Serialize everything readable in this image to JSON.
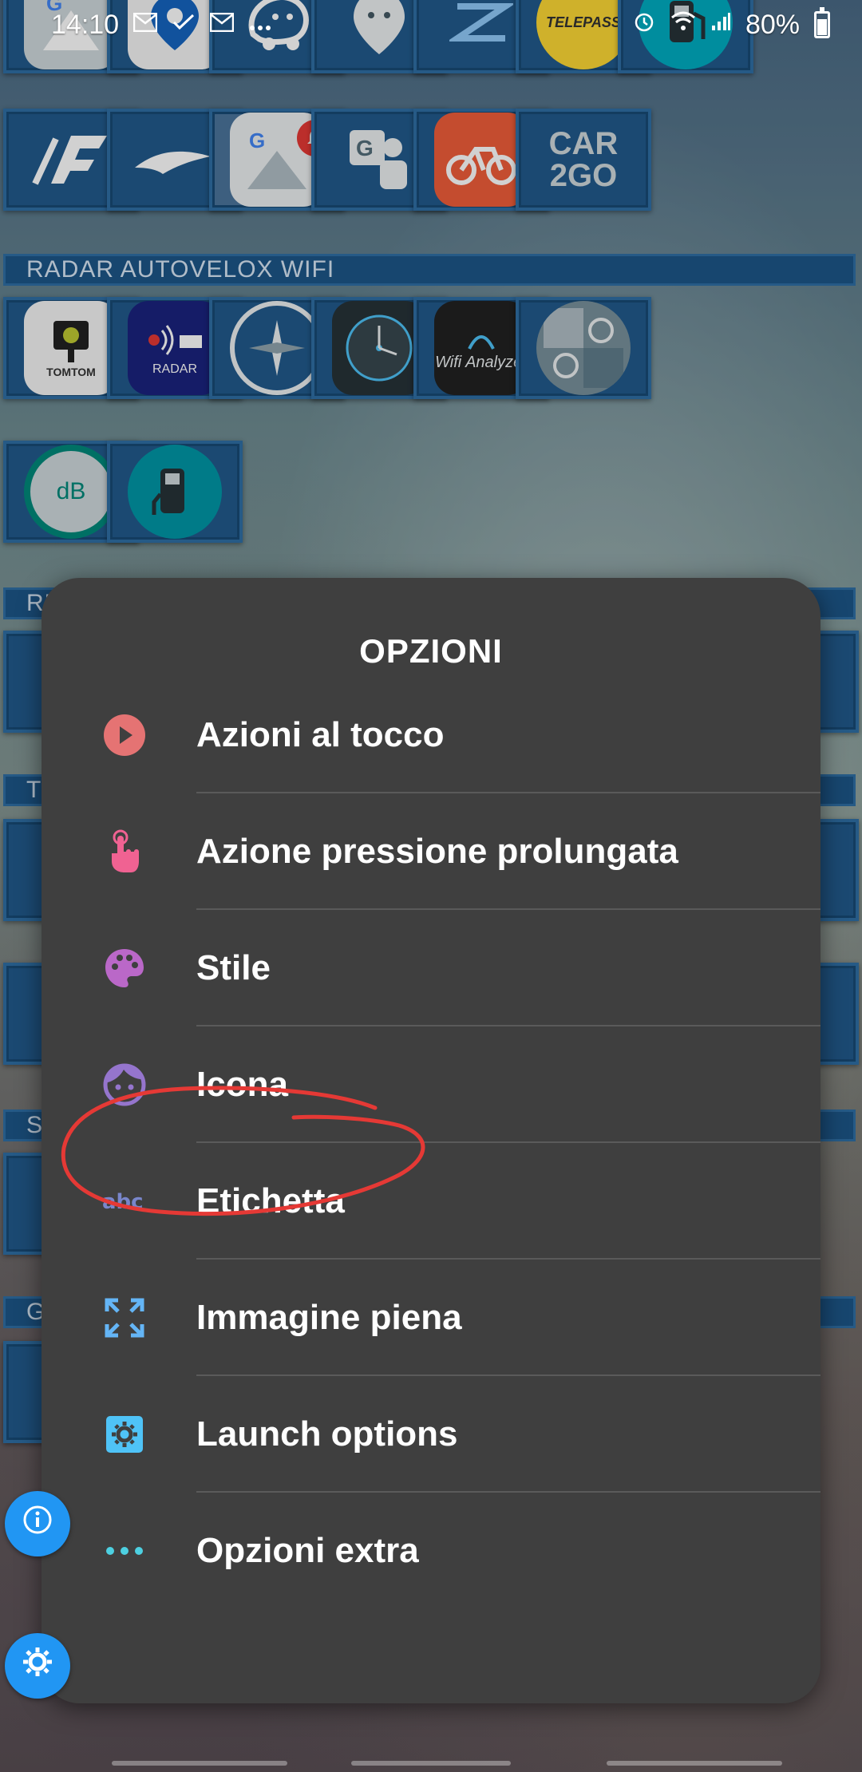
{
  "status_bar": {
    "time": "14:10",
    "battery": "80%"
  },
  "home": {
    "sections": {
      "radar": "RADAR AUTOVELOX WIFI",
      "re": "RE",
      "t": "T",
      "s": "S",
      "g": "G"
    },
    "app_labels": {
      "car2go": "CAR 2GO",
      "tomtom": "TOMTOM",
      "radar": "RADAR",
      "wifi_analyzer": "Wifi Analyzer",
      "db": "dB",
      "telepass": "TELEPASS"
    }
  },
  "dialog": {
    "title": "OPZIONI",
    "items": [
      {
        "label": "Azioni al tocco",
        "icon": "play-circle-icon",
        "color": "#e57373"
      },
      {
        "label": "Azione pressione prolungata",
        "icon": "touch-hand-icon",
        "color": "#f06292"
      },
      {
        "label": "Stile",
        "icon": "palette-icon",
        "color": "#ba68c8"
      },
      {
        "label": "Icona",
        "icon": "face-icon",
        "color": "#9575cd"
      },
      {
        "label": "Etichetta",
        "icon": "abc-icon",
        "color": "#7986cb"
      },
      {
        "label": "Immagine piena",
        "icon": "fullscreen-icon",
        "color": "#64b5f6"
      },
      {
        "label": "Launch options",
        "icon": "settings-box-icon",
        "color": "#4fc3f7"
      },
      {
        "label": "Opzioni extra",
        "icon": "more-dots-icon",
        "color": "#4dd0e1"
      }
    ]
  },
  "annotation": {
    "color": "#e53935"
  }
}
